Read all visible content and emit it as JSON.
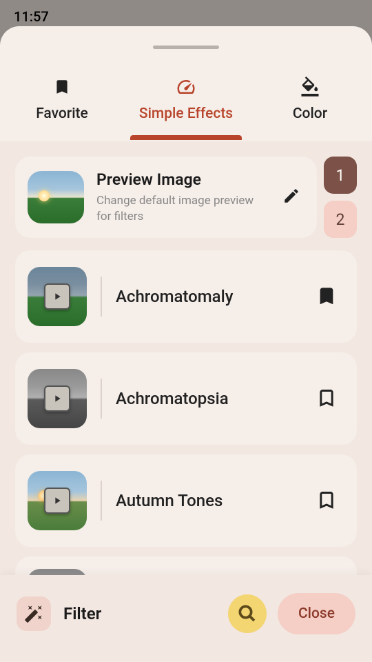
{
  "status": {
    "time": "11:57"
  },
  "tabs": {
    "favorite": "Favorite",
    "simple": "Simple Effects",
    "color": "Color"
  },
  "preview": {
    "title": "Preview Image",
    "subtitle": "Change default image preview for filters"
  },
  "sets": {
    "one": "1",
    "two": "2"
  },
  "filters": [
    {
      "name": "Achromatomaly",
      "bookmarked": true
    },
    {
      "name": "Achromatopsia",
      "bookmarked": false
    },
    {
      "name": "Autumn Tones",
      "bookmarked": false
    }
  ],
  "bottom": {
    "filter": "Filter",
    "close": "Close"
  }
}
